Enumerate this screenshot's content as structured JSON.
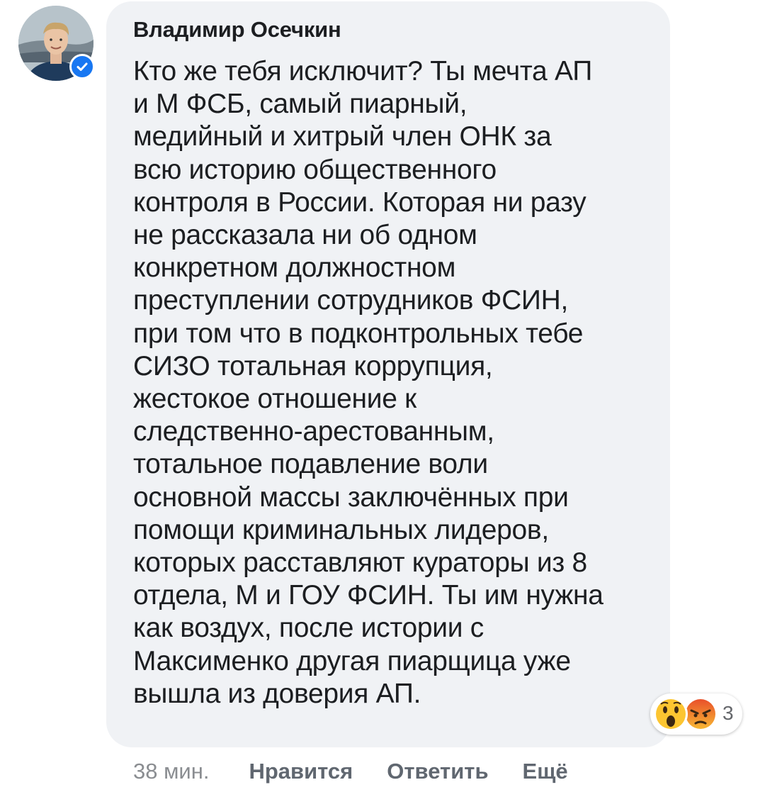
{
  "comment": {
    "author": "Владимир Осечкин",
    "text": "Кто же тебя исключит? Ты мечта АП\nи М ФСБ, самый пиарный,\nмедийный и хитрый член ОНК за\nвсю историю общественного\nконтроля в России. Которая ни разу\nне рассказала ни об одном\nконкретном должностном\nпреступлении сотрудников ФСИН,\nпри том что в подконтрольных тебе\nСИЗО тотальная коррупция,\nжестокое отношение к\nследственно-арестованным,\nтотальное подавление воли\nосновной массы заключённых при\nпомощи криминальных лидеров,\nкоторых расставляют кураторы из 8\nотдела, М и ГОУ ФСИН. Ты им нужна\nкак воздух, после истории с\nМаксименко другая пиарщица уже\nвышла из доверия АП.",
    "verified": true
  },
  "reactions": {
    "icons": [
      "wow-icon",
      "angry-icon"
    ],
    "count": "3"
  },
  "actions": {
    "timestamp": "38 мин.",
    "like_label": "Нравится",
    "reply_label": "Ответить",
    "more_label": "Ещё"
  },
  "colors": {
    "bubble": "#f0f2f5",
    "text": "#1c1e21",
    "verified": "#1877f2",
    "action": "#606770",
    "timestamp": "#8a8d91"
  }
}
